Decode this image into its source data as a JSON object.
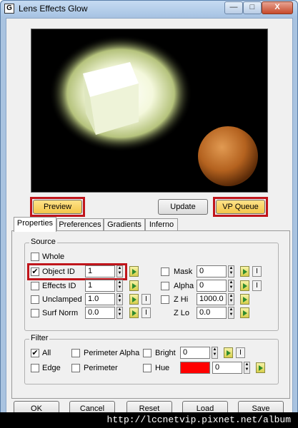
{
  "window": {
    "title": "Lens Effects Glow",
    "app_icon_letter": "G",
    "minimize_glyph": "—",
    "maximize_glyph": "□",
    "close_glyph": "X"
  },
  "preview_buttons": {
    "preview": "Preview",
    "update": "Update",
    "vp_queue": "VP Queue"
  },
  "tabs": [
    "Properties",
    "Preferences",
    "Gradients",
    "Inferno"
  ],
  "source": {
    "label": "Source",
    "whole": "Whole",
    "object_id": {
      "label": "Object ID",
      "value": "1",
      "checked": true
    },
    "effects_id": {
      "label": "Effects ID",
      "value": "1"
    },
    "unclamped": {
      "label": "Unclamped",
      "value": "1.0"
    },
    "surf_norm": {
      "label": "Surf Norm",
      "value": "0.0"
    },
    "mask": {
      "label": "Mask",
      "value": "0"
    },
    "alpha": {
      "label": "Alpha",
      "value": "0"
    },
    "z_hi": {
      "label": "Z Hi",
      "value": "1000.0"
    },
    "z_lo": {
      "label": "Z Lo",
      "value": "0.0"
    },
    "i_label": "I"
  },
  "filter": {
    "label": "Filter",
    "all": "All",
    "all_checked": true,
    "edge": "Edge",
    "perimeter_alpha": "Perimeter Alpha",
    "perimeter": "Perimeter",
    "bright": {
      "label": "Bright",
      "value": "0"
    },
    "hue": {
      "label": "Hue",
      "value": "0",
      "color": "#ff0000"
    }
  },
  "bottom_buttons": [
    "OK",
    "Cancel",
    "Reset",
    "Load",
    "Save"
  ],
  "watermark": "http://lccnetvip.pixnet.net/album",
  "colors": {
    "highlight_border": "#c0151b",
    "active_button": "#f3c64a"
  }
}
